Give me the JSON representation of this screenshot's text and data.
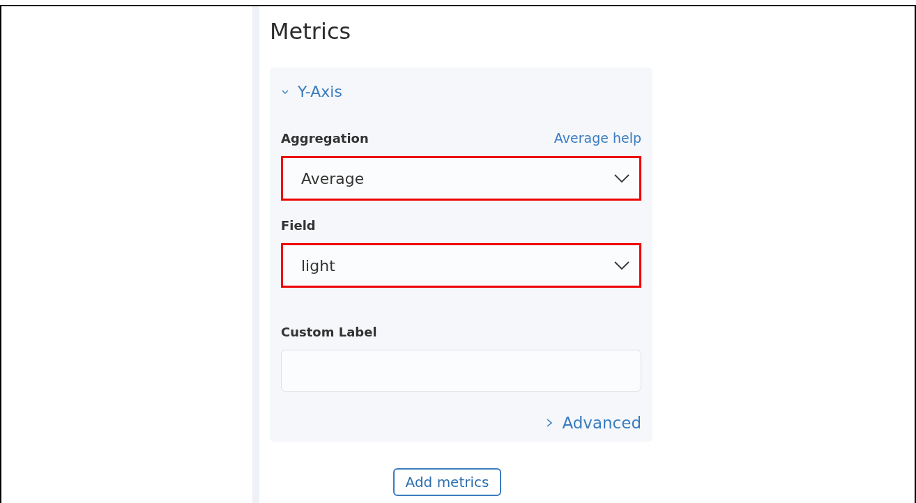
{
  "title": "Metrics",
  "section": {
    "label": "Y-Axis",
    "expanded": true
  },
  "fields": [
    {
      "kind": "select",
      "label": "Aggregation",
      "help": "Average help",
      "value": "Average",
      "highlighted": true
    },
    {
      "kind": "select",
      "label": "Field",
      "value": "light",
      "highlighted": true
    },
    {
      "kind": "text",
      "label": "Custom Label"
    }
  ],
  "advanced": {
    "label": "Advanced",
    "expanded": false
  },
  "add_button": "Add metrics"
}
